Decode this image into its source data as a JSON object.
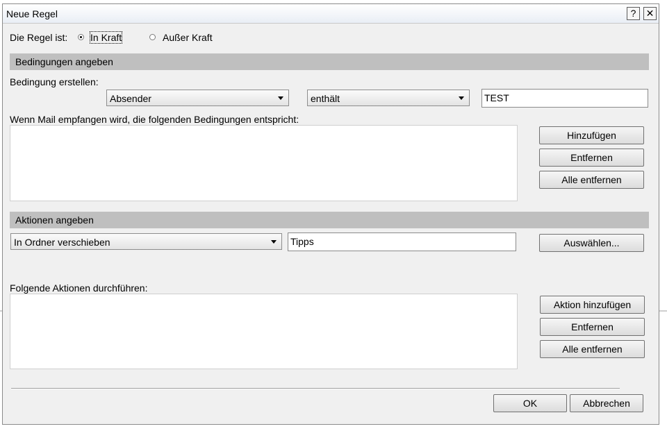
{
  "window": {
    "title": "Neue Regel",
    "help_label": "?",
    "close_label": "✕"
  },
  "rule_state": {
    "label": "Die Regel ist:",
    "options": [
      {
        "label": "In Kraft",
        "checked": true
      },
      {
        "label": "Außer Kraft",
        "checked": false
      }
    ]
  },
  "conditions": {
    "section_title": "Bedingungen angeben",
    "create_label": "Bedingung erstellen:",
    "field_select": "Absender",
    "operator_select": "enthält",
    "value_input": "TEST",
    "list_label": "Wenn Mail empfangen wird, die folgenden Bedingungen entspricht:",
    "buttons": {
      "add": "Hinzufügen",
      "remove": "Entfernen",
      "remove_all": "Alle entfernen"
    }
  },
  "actions": {
    "section_title": "Aktionen angeben",
    "action_select": "In Ordner verschieben",
    "target_input": "Tipps",
    "choose_button": "Auswählen...",
    "list_label": "Folgende Aktionen durchführen:",
    "buttons": {
      "add": "Aktion hinzufügen",
      "remove": "Entfernen",
      "remove_all": "Alle entfernen"
    }
  },
  "footer": {
    "ok": "OK",
    "cancel": "Abbrechen"
  }
}
